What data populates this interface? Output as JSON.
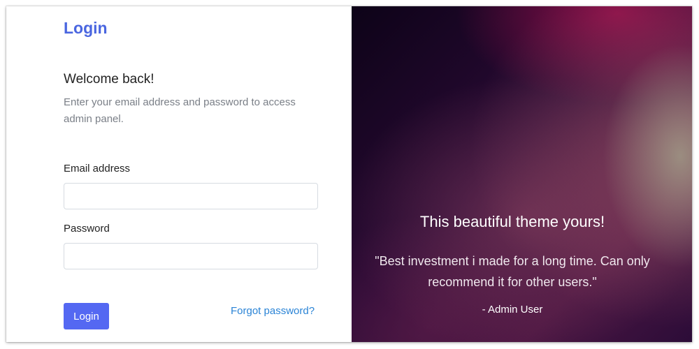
{
  "brand": "Login",
  "welcome_title": "Welcome back!",
  "welcome_subtitle": "Enter your email address and password to access admin panel.",
  "form": {
    "email_label": "Email address",
    "email_value": "",
    "password_label": "Password",
    "password_value": "",
    "submit_label": "Login",
    "forgot_label": "Forgot password?"
  },
  "testimonial": {
    "title": "This beautiful theme yours!",
    "quote": "\"Best investment i made for a long time. Can only recommend it for other users.\"",
    "author": "- Admin User"
  },
  "colors": {
    "accent": "#5468f2",
    "brand": "#4a66e0",
    "link": "#2b84d6"
  }
}
